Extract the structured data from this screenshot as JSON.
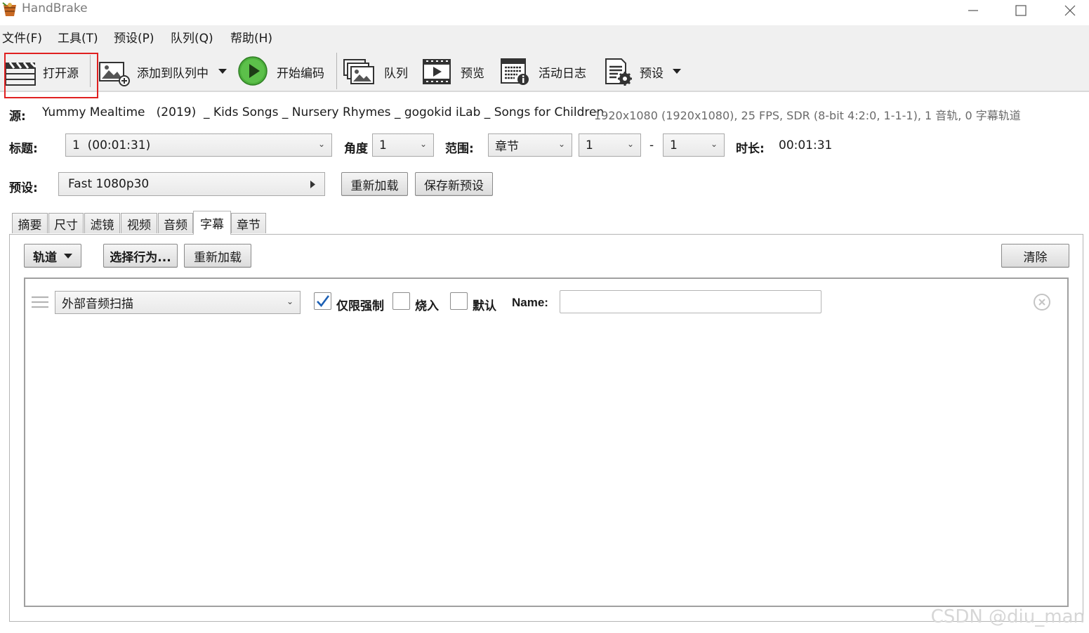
{
  "window": {
    "title": "HandBrake",
    "controls": [
      "minimize",
      "maximize",
      "close"
    ]
  },
  "menu": {
    "items": [
      {
        "label": "文件(F)"
      },
      {
        "label": "工具(T)"
      },
      {
        "label": "预设(P)"
      },
      {
        "label": "队列(Q)"
      },
      {
        "label": "帮助(H)"
      }
    ]
  },
  "toolbar": {
    "open_source": "打开源",
    "add_to_queue": "添加到队列中",
    "start_encode": "开始编码",
    "queue": "队列",
    "preview": "预览",
    "activity_log": "活动日志",
    "presets": "预设"
  },
  "source": {
    "label": "源:",
    "name": "Yummy Mealtime   (2019)  _ Kids Songs _ Nursery Rhymes _ gogokid iLab _ Songs for Children",
    "info": "1920x1080 (1920x1080), 25 FPS, SDR (8-bit 4:2:0, 1-1-1), 1 音轨, 0 字幕轨道"
  },
  "title_row": {
    "title_label": "标题:",
    "title_value": "1  (00:01:31)",
    "angle_label": "角度",
    "angle_value": "1",
    "range_label": "范围:",
    "range_type": "章节",
    "range_start": "1",
    "range_dash": "-",
    "range_end": "1",
    "duration_label": "时长:",
    "duration_value": "00:01:31"
  },
  "preset_row": {
    "label": "预设:",
    "value": "Fast 1080p30",
    "reload": "重新加载",
    "save_new": "保存新预设"
  },
  "tabs": [
    {
      "label": "摘要"
    },
    {
      "label": "尺寸"
    },
    {
      "label": "滤镜"
    },
    {
      "label": "视频"
    },
    {
      "label": "音频"
    },
    {
      "label": "字幕",
      "active": true
    },
    {
      "label": "章节"
    }
  ],
  "subtitles": {
    "tracks_button": "轨道",
    "choose_behavior": "选择行为...",
    "reload": "重新加载",
    "clear": "清除",
    "track": {
      "source": "外部音频扫描",
      "forced_only_label": "仅限强制",
      "forced_only": true,
      "burn_in_label": "烧入",
      "burn_in": false,
      "default_label": "默认",
      "default": false,
      "name_label": "Name:",
      "name_value": ""
    }
  },
  "watermark": "CSDN @diu_man",
  "colors": {
    "highlight_red": "#e02020",
    "check_blue": "#1b5fb4",
    "play_green": "#4caf3c"
  }
}
